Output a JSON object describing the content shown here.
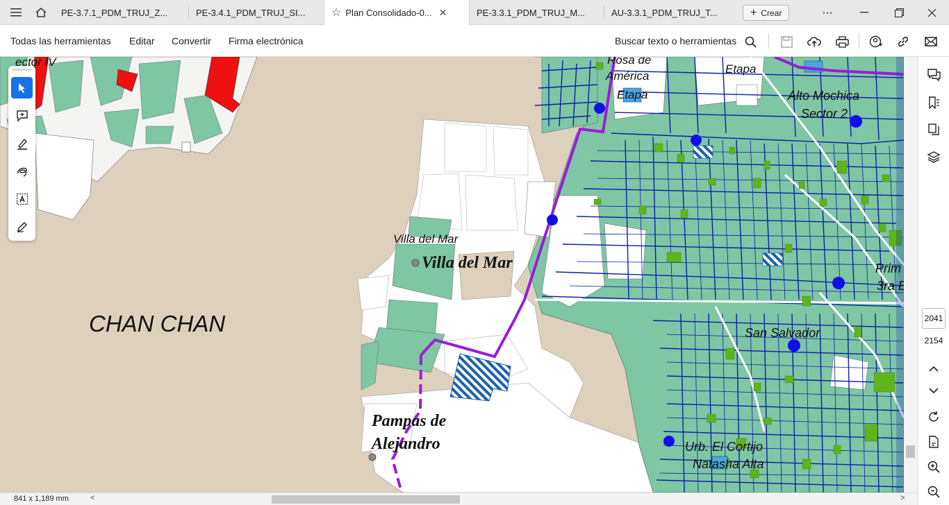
{
  "tabs": [
    {
      "label": "PE-3.7.1_PDM_TRUJ_Z..."
    },
    {
      "label": "PE-3.4.1_PDM_TRUJ_SI..."
    },
    {
      "label": "Plan Consolidado-0..."
    },
    {
      "label": "PE-3.3.1_PDM_TRUJ_M..."
    },
    {
      "label": "AU-3.3.1_PDM_TRUJ_T..."
    }
  ],
  "create_label": "Crear",
  "menu": {
    "all_tools": "Todas las herramientas",
    "edit": "Editar",
    "convert": "Convertir",
    "esign": "Firma electrónica",
    "search": "Buscar texto o herramientas"
  },
  "map_labels": {
    "sector_iv": "ector IV",
    "rosa_de": "Rosa de",
    "america": "América",
    "etapa_left": "Etapa",
    "etapa_top": "Etapa",
    "alto_mochica": "Alto Mochica",
    "sector_2": "Sector 2",
    "villa_small": "Villa del Mar",
    "villa_big": "Villa del Mar",
    "chan_chan": "CHAN CHAN",
    "san_salvador": "San Salvador",
    "pampas_1": "Pampas de",
    "pampas_2": "Alejandro",
    "urb_cortijo": "Urb. El Cortijo",
    "natasha": "Natasha Alta",
    "prim_1": "Prim",
    "prim_2": "3ra E"
  },
  "page": {
    "current": "2041",
    "total": "2154"
  },
  "page_size": "841 x 1,189 mm",
  "colors": {
    "desert": "#ddd0bd",
    "urban_green": "#7fc6a4",
    "road_blue": "#0a1fa8",
    "boundary_purple": "#9a1dd6",
    "park_green": "#5fb41c",
    "red_lot": "#ee1111",
    "accent": "#1473e6"
  }
}
